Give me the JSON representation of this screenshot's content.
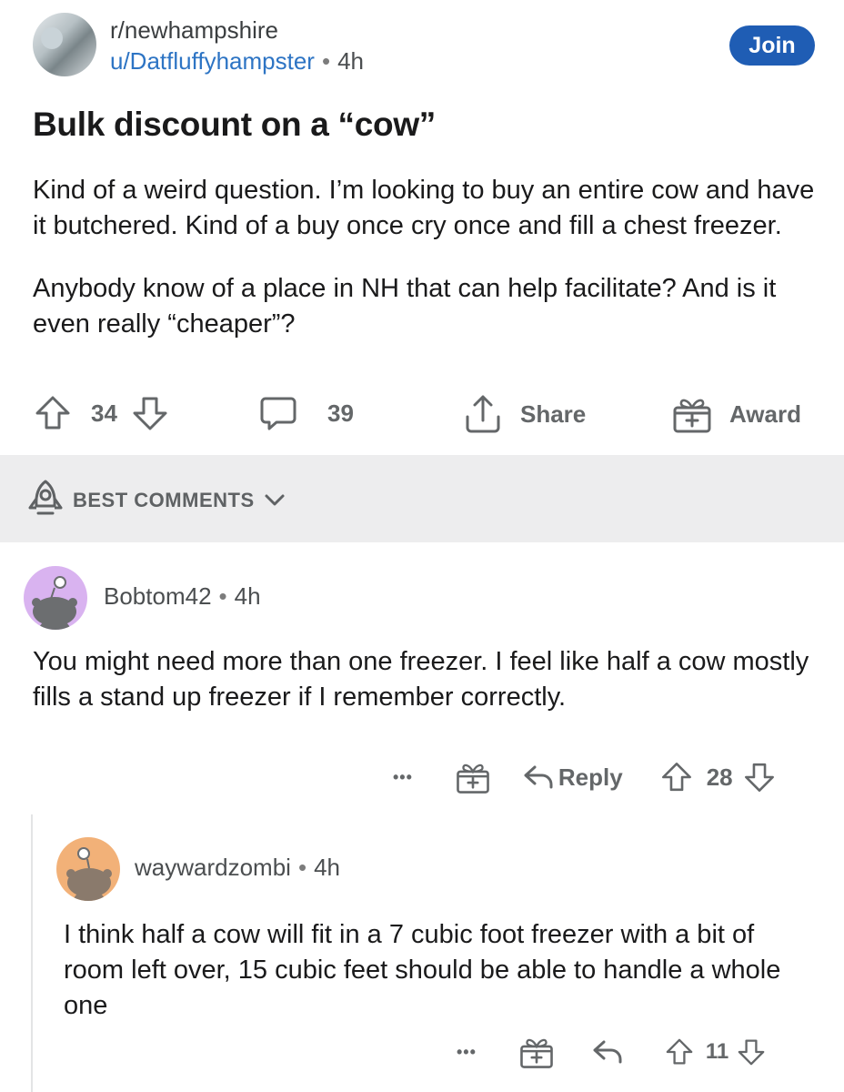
{
  "post": {
    "subreddit": "r/newhampshire",
    "author": "u/Datfluffyhampster",
    "age": "4h",
    "join_label": "Join",
    "title": "Bulk discount on a “cow”",
    "body": [
      "Kind of a weird question. I’m looking to buy an entire cow and have it butchered. Kind of a buy once cry once and fill a chest freezer.",
      "Anybody know of a place in NH that can help facilitate? And is it even really “cheaper”?"
    ],
    "votes": "34",
    "comments": "39",
    "share_label": "Share",
    "award_label": "Award"
  },
  "sort": {
    "label": "BEST COMMENTS"
  },
  "comments": [
    {
      "author": "Bobtom42",
      "age": "4h",
      "avatar_color": "#d9b3f0",
      "body": "You might need more than one freezer. I feel like half a cow mostly fills a stand up freezer if I remember correctly.",
      "more": "•••",
      "reply_label": "Reply",
      "votes": "28"
    },
    {
      "author": "waywardzombi",
      "age": "4h",
      "avatar_color": "#f2b178",
      "body": "I think half a cow will fit in a 7 cubic foot freezer with a bit of room left over, 15 cubic feet should be able to handle a whole one",
      "more": "•••",
      "votes": "11"
    }
  ],
  "icons": {
    "upvote": "upvote-arrow-icon",
    "downvote": "downvote-arrow-icon",
    "comment": "speech-bubble-icon",
    "share": "share-upload-icon",
    "award": "gift-box-icon",
    "rocket": "rocket-icon",
    "chevron": "chevron-down-icon",
    "reply": "reply-arrow-icon"
  },
  "colors": {
    "join_bg": "#1f5db4",
    "username_link": "#2d74c4",
    "band_bg": "#ededee",
    "meta_gray": "#646769"
  }
}
